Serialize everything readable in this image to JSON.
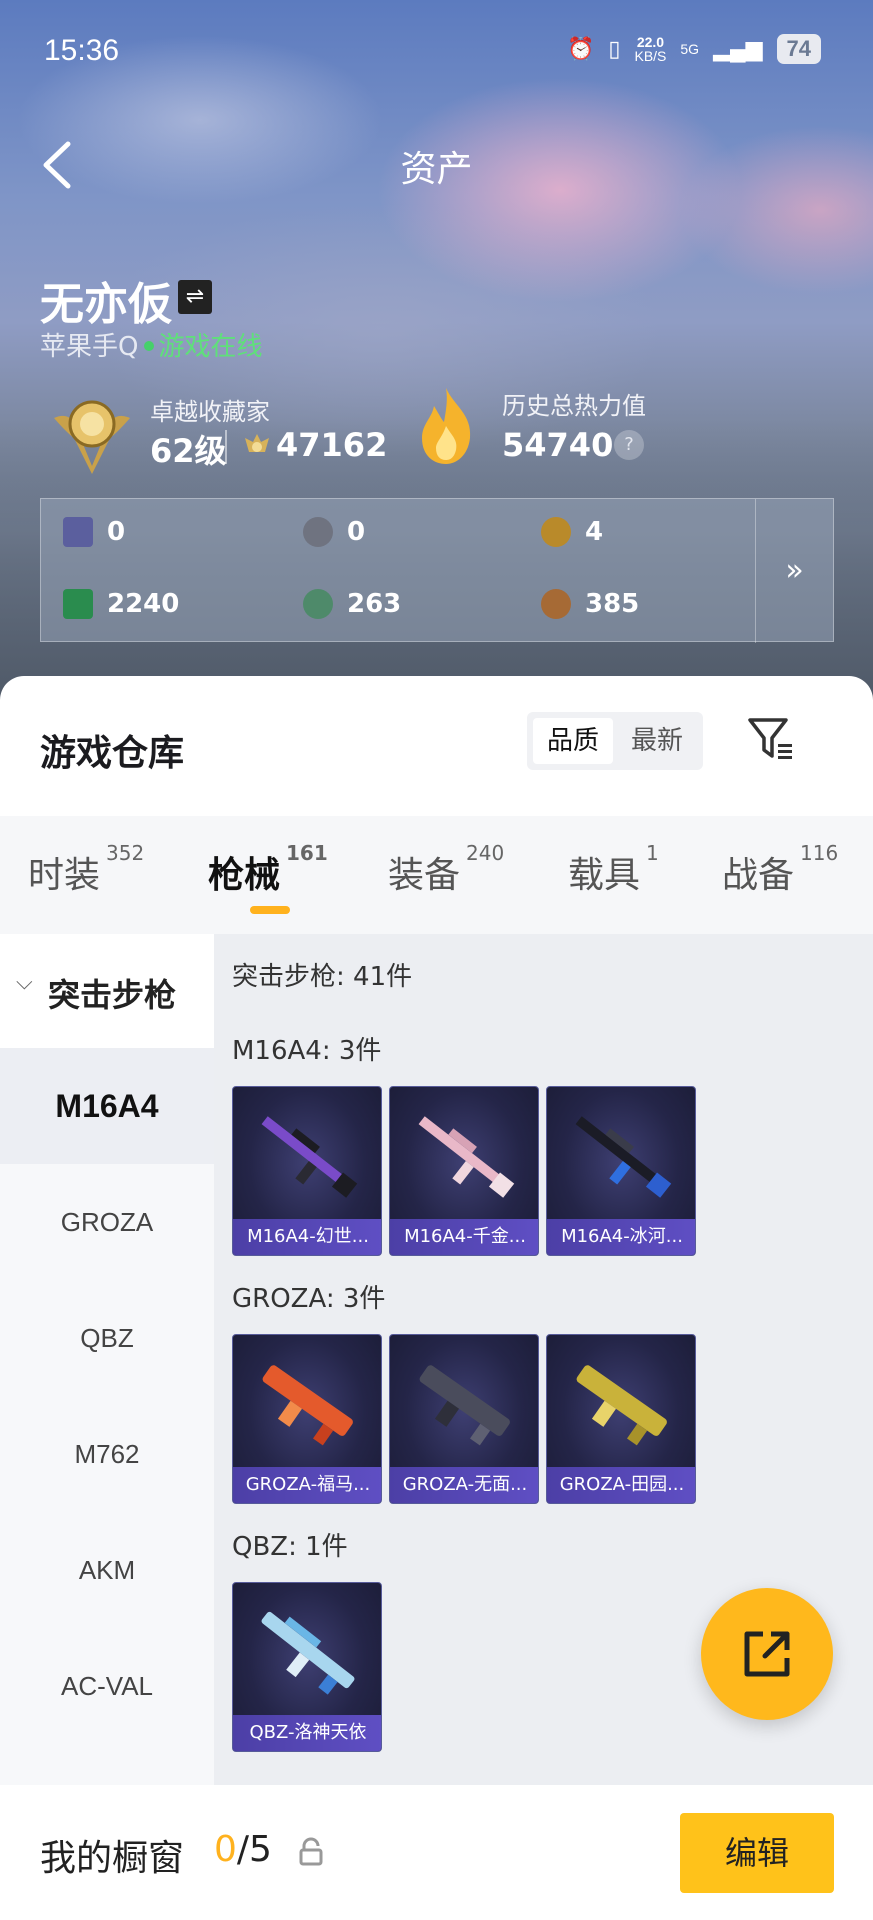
{
  "status": {
    "time": "15:36",
    "speed": "22.0",
    "speed_unit": "KB/S",
    "net": "5G",
    "battery": "74"
  },
  "header": {
    "title": "资产"
  },
  "profile": {
    "name": "无亦仮",
    "swap_icon": "⇌",
    "account": "苹果手Q",
    "online": "游戏在线",
    "level_label": "卓越收藏家",
    "level": "62级",
    "points": "47162",
    "heat_label": "历史总热力值",
    "heat": "54740",
    "help": "?"
  },
  "stats": [
    {
      "value": "0",
      "color": "#5b5f9e"
    },
    {
      "value": "0",
      "color": "#6f7380"
    },
    {
      "value": "4",
      "color": "#b98a2a"
    },
    {
      "value": "2240",
      "color": "#2a8c4e"
    },
    {
      "value": "263",
      "color": "#4e8a6a"
    },
    {
      "value": "385",
      "color": "#a66a35"
    }
  ],
  "stats_more": "»",
  "warehouse": {
    "title": "游戏仓库",
    "sort": [
      "品质",
      "最新"
    ],
    "tabs": [
      {
        "label": "时装",
        "count": "352"
      },
      {
        "label": "枪械",
        "count": "161"
      },
      {
        "label": "装备",
        "count": "240"
      },
      {
        "label": "载具",
        "count": "1"
      },
      {
        "label": "战备",
        "count": "116"
      }
    ],
    "category": "突击步枪",
    "side_items": [
      "M16A4",
      "GROZA",
      "QBZ",
      "M762",
      "AKM",
      "AC-VAL"
    ],
    "summary": "突击步枪: 41件",
    "sections": [
      {
        "head": "M16A4: 3件",
        "items": [
          "M16A4-幻世...",
          "M16A4-千金...",
          "M16A4-冰河..."
        ]
      },
      {
        "head": "GROZA: 3件",
        "items": [
          "GROZA-福马...",
          "GROZA-无面...",
          "GROZA-田园..."
        ]
      },
      {
        "head": "QBZ: 1件",
        "items": [
          "QBZ-洛神天依"
        ]
      }
    ]
  },
  "footer": {
    "label": "我的橱窗",
    "current": "0",
    "total": "/5",
    "edit": "编辑"
  }
}
